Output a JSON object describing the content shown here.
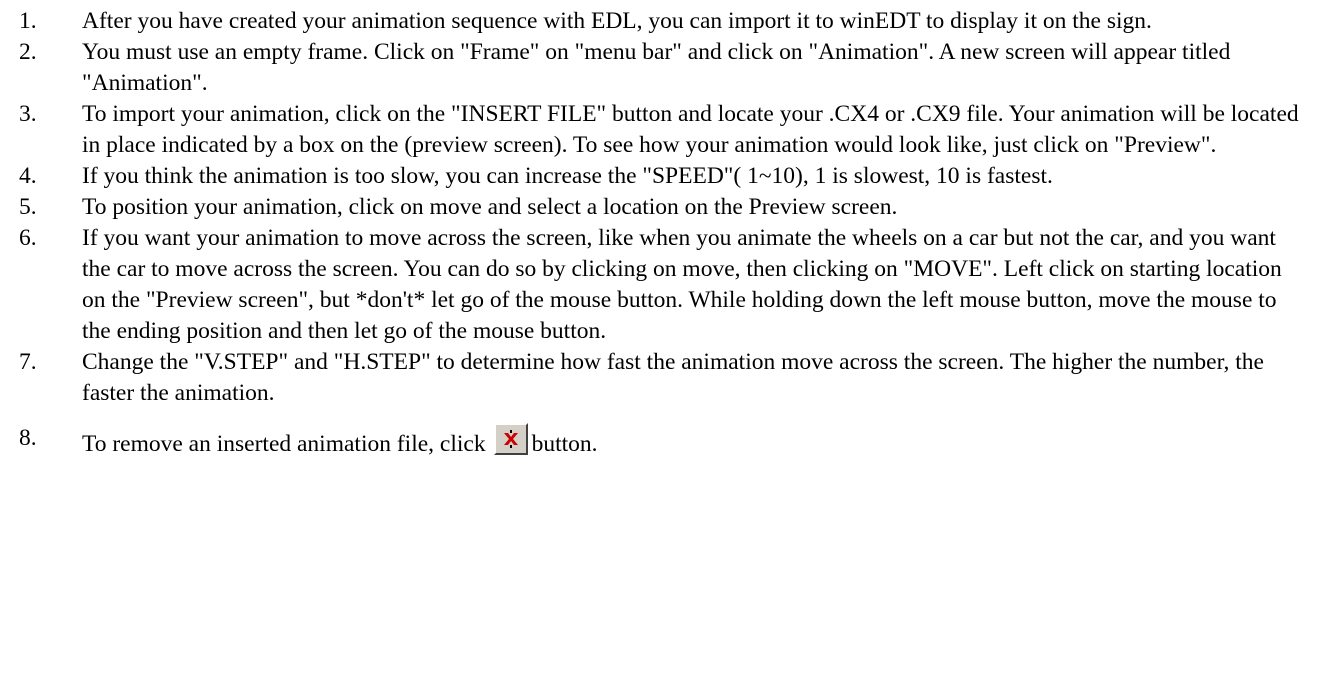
{
  "steps": [
    {
      "number": "1.",
      "text": "After you have created your animation sequence with EDL, you can import it to winEDT to display it on the sign."
    },
    {
      "number": "2.",
      "text": "You must use an empty frame.  Click on \"Frame\" on \"menu bar\" and click on \"Animation\".  A new screen will appear titled \"Animation\"."
    },
    {
      "number": "3.",
      "text": "To import your animation, click on the \"INSERT FILE\" button and locate your .CX4 or .CX9 file.  Your animation will be located in place indicated by a box on the (preview screen).  To see how your animation would look like, just click on \"Preview\"."
    },
    {
      "number": "4.",
      "text": "If you think the animation is too slow, you can increase the \"SPEED\"( 1~10), 1 is slowest, 10 is fastest."
    },
    {
      "number": "5.",
      "text": "To position your animation, click on move and select a location on the Preview screen."
    },
    {
      "number": "6.",
      "text": "If you want your animation to move across the screen, like when you animate the wheels on a car but not the car, and you want the car to move across the screen.  You can do so by clicking on move, then clicking on \"MOVE\".  Left click on starting location on the \"Preview screen\", but *don't* let go of the mouse button.  While holding down the left mouse button, move the mouse to the ending position and then let go of the mouse button."
    },
    {
      "number": "7.",
      "text": "Change the \"V.STEP\" and \"H.STEP\" to determine how fast the animation move across the screen.  The higher the number, the faster the animation."
    }
  ],
  "last_step": {
    "number": "8.",
    "text_before": "To remove an inserted animation file, click",
    "text_after": "button.",
    "icon": "remove-x-icon",
    "icon_color": "#cc0000"
  }
}
